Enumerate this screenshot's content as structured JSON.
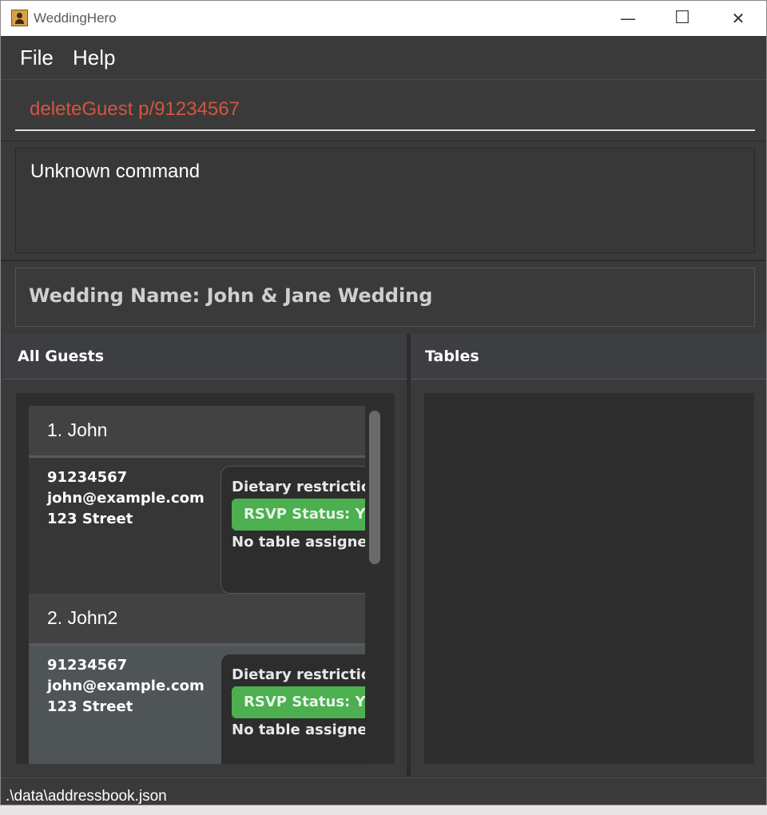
{
  "window": {
    "title": "WeddingHero",
    "minimize_glyph": "—",
    "maximize_glyph": "☐",
    "close_glyph": "✕"
  },
  "menu": {
    "items": [
      {
        "label": "File"
      },
      {
        "label": "Help"
      }
    ]
  },
  "command": {
    "value": "deleteGuest p/91234567",
    "error_color": "#d4553f"
  },
  "result": {
    "text": "Unknown command"
  },
  "wedding": {
    "label": "Wedding Name: John & Jane Wedding"
  },
  "guests_panel": {
    "title": "All Guests",
    "guests": [
      {
        "name": "1. John",
        "phone": "91234567",
        "email": "john@example.com",
        "address": "123 Street",
        "dietary": "Dietary restriction",
        "rsvp": "RSVP Status: YES",
        "table": "No table assigned"
      },
      {
        "name": "2. John2",
        "phone": "91234567",
        "email": "john@example.com",
        "address": "123 Street",
        "dietary": "Dietary restriction",
        "rsvp": "RSVP Status: YES",
        "table": "No table assigned"
      }
    ]
  },
  "tables_panel": {
    "title": "Tables"
  },
  "status": {
    "path": ".\\data\\addressbook.json"
  },
  "colors": {
    "background": "#3a3a3a",
    "rsvp_yes": "#4caf50"
  }
}
